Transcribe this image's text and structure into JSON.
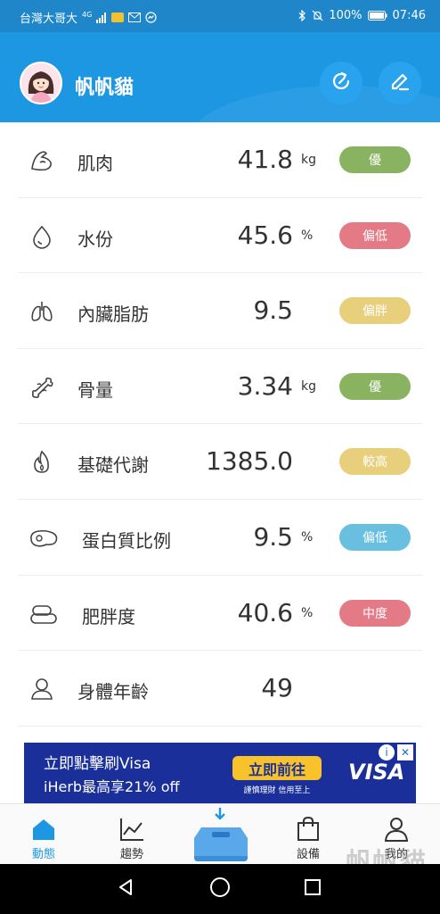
{
  "status_bar": {
    "carrier": "台灣大哥大",
    "network": "4G",
    "battery": "100%",
    "time": "07:46"
  },
  "header": {
    "username": "帆帆貓",
    "refresh_icon": "refresh-icon",
    "edit_icon": "edit-icon"
  },
  "metrics": [
    {
      "label": "肌肉",
      "value": "41.8",
      "unit": "kg",
      "badge": "優",
      "color": "#8ab361",
      "icon": "muscle-icon"
    },
    {
      "label": "水份",
      "value": "45.6",
      "unit": "%",
      "badge": "偏低",
      "color": "#e47a86",
      "icon": "water-drop-icon"
    },
    {
      "label": "內臟脂肪",
      "value": "9.5",
      "unit": "",
      "badge": "偏胖",
      "color": "#e8cf7c",
      "icon": "lungs-icon"
    },
    {
      "label": "骨量",
      "value": "3.34",
      "unit": "kg",
      "badge": "優",
      "color": "#8ab361",
      "icon": "bone-icon"
    },
    {
      "label": "基礎代謝",
      "value": "1385.0",
      "unit": "",
      "badge": "較高",
      "color": "#e8cf7c",
      "icon": "flame-icon"
    },
    {
      "label": "蛋白質比例",
      "value": "9.5",
      "unit": "%",
      "badge": "偏低",
      "color": "#68bfe0",
      "icon": "protein-icon"
    },
    {
      "label": "肥胖度",
      "value": "40.6",
      "unit": "%",
      "badge": "中度",
      "color": "#e47a86",
      "icon": "obesity-icon"
    },
    {
      "label": "身體年齡",
      "value": "49",
      "unit": "",
      "badge": "",
      "color": "",
      "icon": "person-icon"
    }
  ],
  "ad": {
    "line1": "立即點擊刷Visa",
    "line2": "iHerb最高享21% off",
    "cta": "立即前往",
    "sub": "謹慎理財 信用至上",
    "brand": "VISA"
  },
  "tabs": [
    {
      "label": "動態",
      "icon": "home-icon"
    },
    {
      "label": "趨勢",
      "icon": "chart-icon"
    },
    {
      "label": "設備",
      "icon": "bag-icon"
    },
    {
      "label": "我的",
      "icon": "user-icon"
    }
  ],
  "colors": {
    "header": "#1e97e3",
    "status_bar": "#1f86c9",
    "active_tab": "#1e97e3"
  },
  "watermark": "帆帆貓"
}
